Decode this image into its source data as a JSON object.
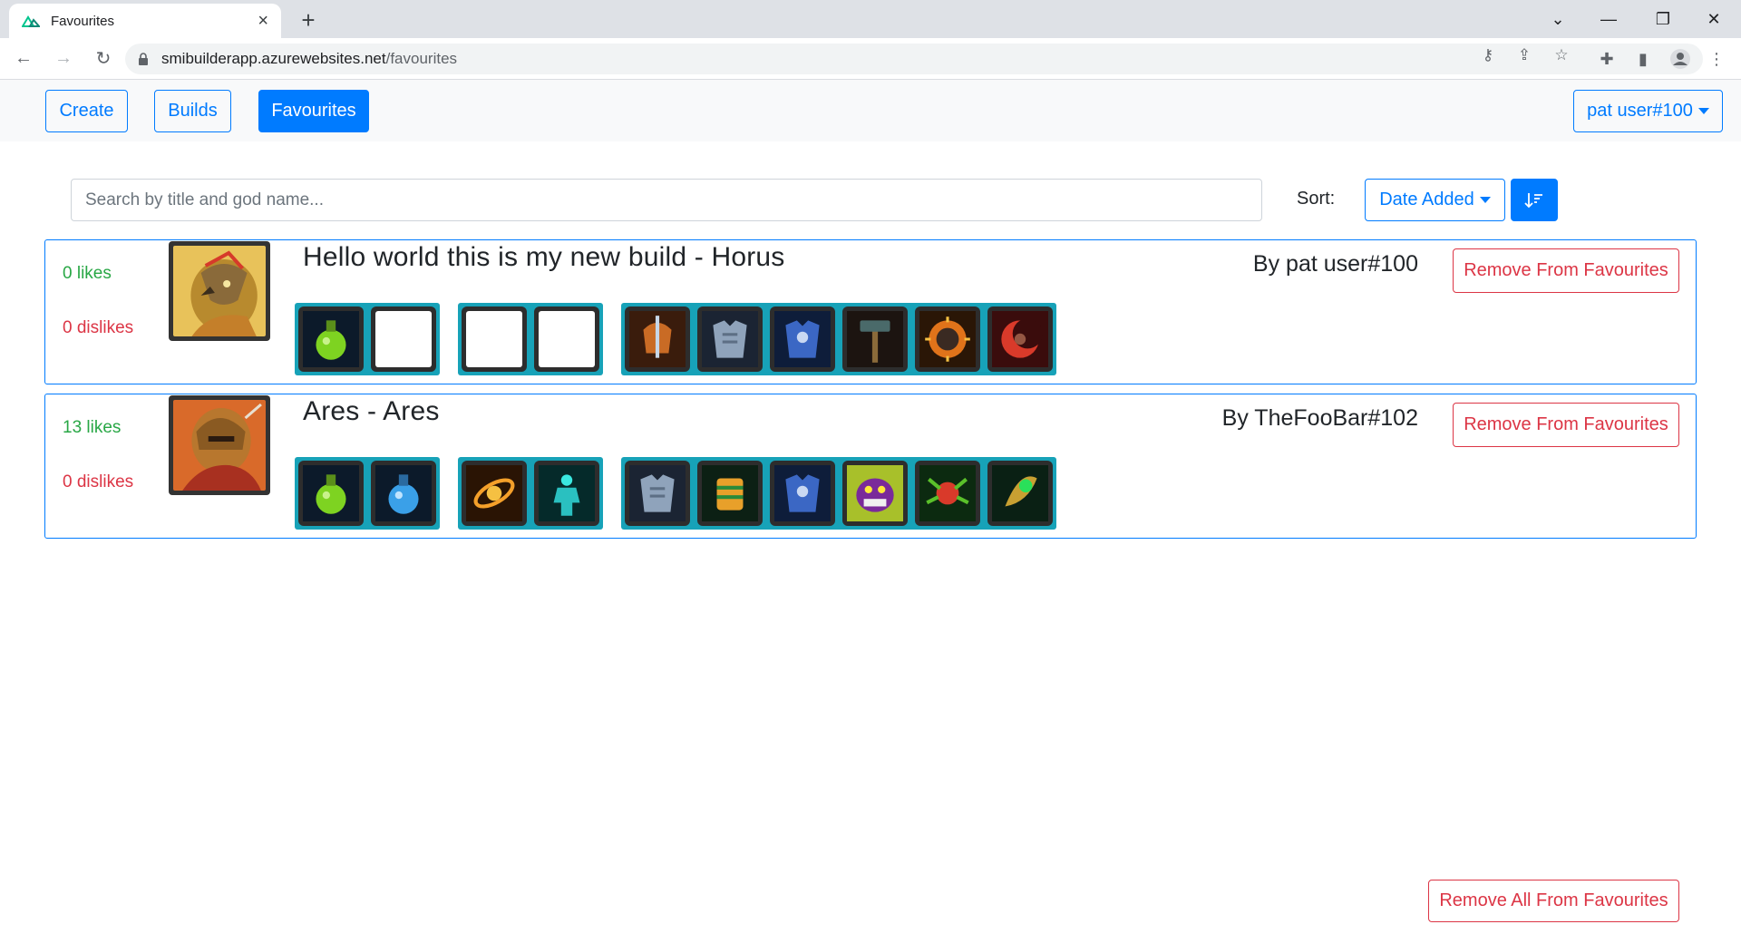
{
  "browser": {
    "tab_title": "Favourites",
    "url_host": "smibuilderapp.azurewebsites.net",
    "url_path": "/favourites"
  },
  "nav": {
    "create_label": "Create",
    "builds_label": "Builds",
    "favourites_label": "Favourites",
    "user_menu_label": "pat user#100"
  },
  "toolbar": {
    "search_placeholder": "Search by title and god name...",
    "sort_label": "Sort:",
    "sort_selected": "Date Added"
  },
  "builds": [
    {
      "likes": "0 likes",
      "dislikes": "0 dislikes",
      "title": "Hello world this is my new build - Horus",
      "author": "By pat user#100",
      "remove_label": "Remove From Favourites",
      "god_icon": "horus-portrait",
      "consumables": [
        "green-potion-icon",
        "empty-slot"
      ],
      "relics": [
        "empty-slot",
        "empty-slot"
      ],
      "items": [
        "sword-armor-icon",
        "chest-armor-icon",
        "blue-armor-icon",
        "hammer-icon",
        "spiked-mace-icon",
        "red-moon-icon"
      ]
    },
    {
      "likes": "13 likes",
      "dislikes": "0 dislikes",
      "title": "Ares - Ares",
      "author": "By TheFooBar#102",
      "remove_label": "Remove From Favourites",
      "god_icon": "ares-portrait",
      "consumables": [
        "green-potion-icon",
        "blue-potion-icon"
      ],
      "relics": [
        "orange-orbit-relic-icon",
        "cyan-body-relic-icon"
      ],
      "items": [
        "chest-armor-icon",
        "green-gauntlet-icon",
        "blue-armor-icon",
        "purple-monster-icon",
        "green-spider-icon",
        "green-gem-icon"
      ]
    }
  ],
  "footer": {
    "remove_all_label": "Remove All From Favourites"
  },
  "colors": {
    "primary": "#007bff",
    "danger": "#dc3545",
    "success": "#28a745",
    "slot_group": "#17a2b8"
  }
}
